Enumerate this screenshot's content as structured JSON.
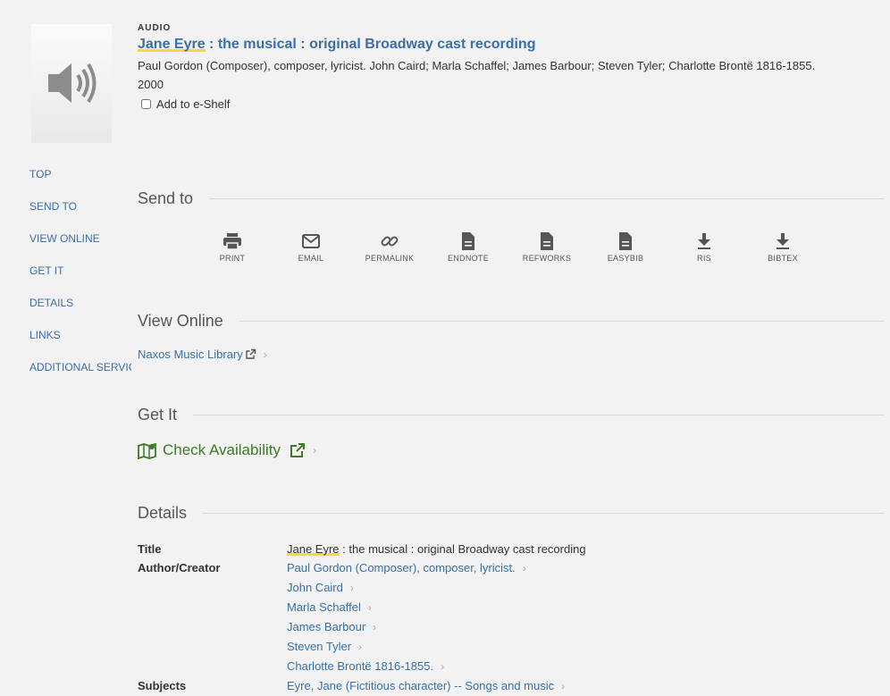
{
  "record": {
    "type": "AUDIO",
    "title_highlight": "Jane Eyre",
    "title_rest": " : the musical : original Broadway cast recording",
    "meta": "Paul Gordon (Composer), composer, lyricist. John Caird; Marla Schaffel; James Barbour; Steven Tyler; Charlotte Brontë 1816-1855. 2000",
    "eshelf_label": "Add to e-Shelf"
  },
  "sidenav": [
    "TOP",
    "SEND TO",
    "VIEW ONLINE",
    "GET IT",
    "DETAILS",
    "LINKS",
    "ADDITIONAL SERVICES"
  ],
  "sections": {
    "send_to": "Send to",
    "view_online": "View Online",
    "get_it": "Get It",
    "details": "Details"
  },
  "send_actions": [
    {
      "label": "PRINT",
      "icon": "print-icon"
    },
    {
      "label": "EMAIL",
      "icon": "email-icon"
    },
    {
      "label": "PERMALINK",
      "icon": "link-icon"
    },
    {
      "label": "ENDNOTE",
      "icon": "document-icon"
    },
    {
      "label": "REFWORKS",
      "icon": "document-icon"
    },
    {
      "label": "EASYBIB",
      "icon": "document-icon"
    },
    {
      "label": "RIS",
      "icon": "download-icon"
    },
    {
      "label": "BIBTEX",
      "icon": "download-icon"
    }
  ],
  "view_online": {
    "link": "Naxos Music Library"
  },
  "get_it": {
    "link": "Check Availability"
  },
  "details": {
    "title_label": "Title",
    "title_highlight": "Jane Eyre",
    "title_rest": " : the musical : original Broadway cast recording",
    "author_label": "Author/Creator",
    "authors": [
      "Paul Gordon (Composer), composer, lyricist.",
      "John Caird",
      "Marla Schaffel",
      "James Barbour",
      "Steven Tyler",
      "Charlotte Brontë 1816-1855."
    ],
    "subjects_label": "Subjects",
    "subjects": [
      "Eyre, Jane (Fictitious character) -- Songs and music"
    ]
  },
  "colors": {
    "link": "#3a6fa8",
    "available": "#3c7a26",
    "highlight": "#f5d942",
    "background": "#f2f2f2"
  }
}
